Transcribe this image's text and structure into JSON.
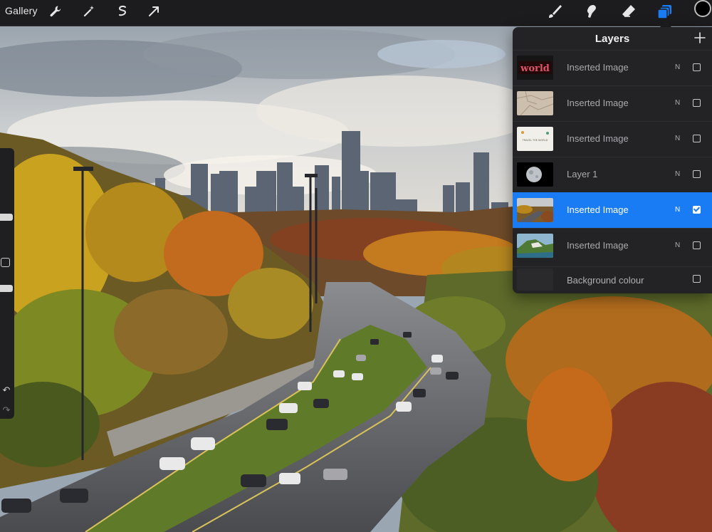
{
  "toolbar": {
    "gallery_label": "Gallery",
    "left_tools": [
      "wrench-icon",
      "magic-wand-icon",
      "selection-icon",
      "transform-arrow-icon"
    ],
    "right_tools": [
      "brush-icon",
      "smudge-icon",
      "eraser-icon",
      "layers-icon"
    ],
    "active_tool": "layers-icon",
    "current_color": "#000000"
  },
  "layers_panel": {
    "title": "Layers",
    "add_icon": "plus-icon",
    "accent_color": "#1a7cf5",
    "layers": [
      {
        "name": "Inserted Image",
        "blend": "N",
        "visible": false,
        "active": false,
        "thumb_text": "world"
      },
      {
        "name": "Inserted Image",
        "blend": "N",
        "visible": false,
        "active": false
      },
      {
        "name": "Inserted Image",
        "blend": "N",
        "visible": false,
        "active": false,
        "thumb_text": "TRAVEL THE WORLD"
      },
      {
        "name": "Layer 1",
        "blend": "N",
        "visible": false,
        "active": false
      },
      {
        "name": "Inserted Image",
        "blend": "N",
        "visible": true,
        "active": true
      },
      {
        "name": "Inserted Image",
        "blend": "N",
        "visible": false,
        "active": false
      }
    ],
    "background": {
      "name": "Background colour",
      "visible": false
    }
  },
  "sidebar": {
    "undo_glyph": "↶",
    "redo_glyph": "↷"
  }
}
